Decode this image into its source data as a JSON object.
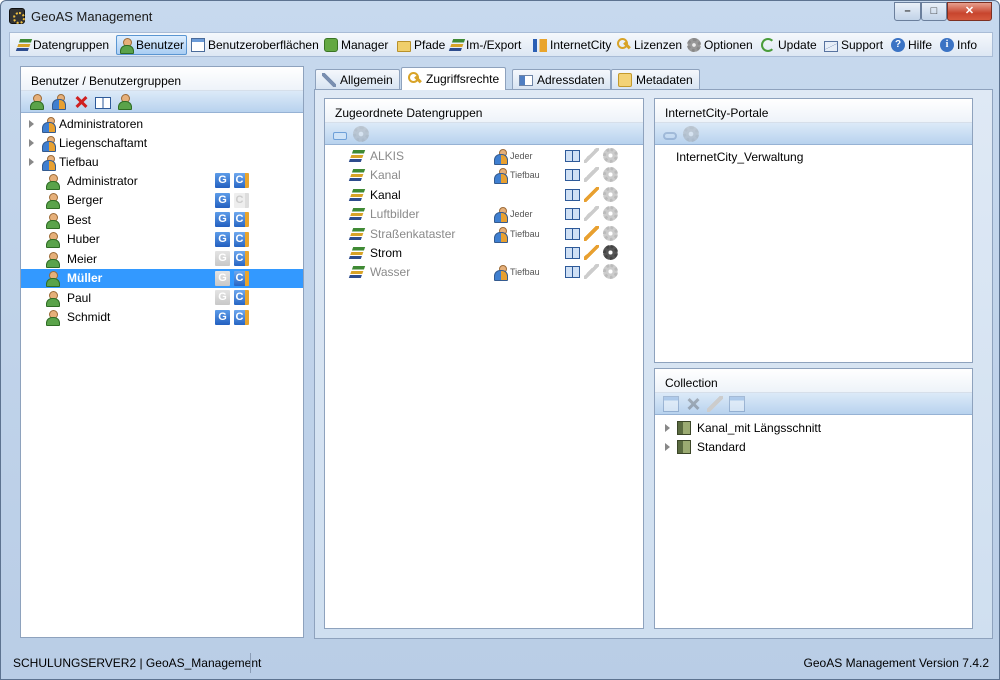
{
  "window": {
    "title": "GeoAS Management",
    "min": "–",
    "max": "□",
    "close": "✕"
  },
  "toolbar": [
    {
      "label": "Datengruppen",
      "icon": "layers-icon"
    },
    {
      "label": "Benutzer",
      "icon": "user-icon"
    },
    {
      "label": "Benutzeroberflächen",
      "icon": "window-icon"
    },
    {
      "label": "Manager",
      "icon": "puzzle-icon"
    },
    {
      "label": "Pfade",
      "icon": "folder-icon"
    },
    {
      "label": "Im-/Export",
      "icon": "layers-icon"
    },
    {
      "label": "InternetCity",
      "icon": "internetcity-icon"
    },
    {
      "label": "Lizenzen",
      "icon": "key-icon"
    },
    {
      "label": "Optionen",
      "icon": "gear-icon"
    },
    {
      "label": "Update",
      "icon": "update-icon"
    },
    {
      "label": "Support",
      "icon": "mail-icon"
    },
    {
      "label": "Hilfe",
      "icon": "help-icon",
      "glyph": "?"
    },
    {
      "label": "Info",
      "icon": "info-icon",
      "glyph": "i"
    }
  ],
  "left_panel": {
    "title": "Benutzer / Benutzergruppen",
    "groups": [
      "Administratoren",
      "Liegenschaftamt",
      "Tiefbau"
    ],
    "users": [
      {
        "name": "Administrator",
        "g": true,
        "c": true
      },
      {
        "name": "Berger",
        "g": true,
        "c": false
      },
      {
        "name": "Best",
        "g": true,
        "c": true
      },
      {
        "name": "Huber",
        "g": true,
        "c": true
      },
      {
        "name": "Meier",
        "g": false,
        "c": true
      },
      {
        "name": "Müller",
        "g": false,
        "c": true,
        "selected": true
      },
      {
        "name": "Paul",
        "g": false,
        "c": true
      },
      {
        "name": "Schmidt",
        "g": true,
        "c": true
      }
    ],
    "badge_g": "G",
    "badge_c": "C"
  },
  "tabs": [
    "Allgemein",
    "Zugriffsrechte",
    "Adressdaten",
    "Metadaten"
  ],
  "datengruppen": {
    "title": "Zugeordnete Datengruppen",
    "rows": [
      {
        "name": "ALKIS",
        "group": "Jeder",
        "active": false,
        "pen": false,
        "gear": false
      },
      {
        "name": "Kanal",
        "group": "Tiefbau",
        "active": false,
        "pen": false,
        "gear": false
      },
      {
        "name": "Kanal",
        "group": "",
        "active": true,
        "pen": true,
        "gear": false
      },
      {
        "name": "Luftbilder",
        "group": "Jeder",
        "active": false,
        "pen": false,
        "gear": false
      },
      {
        "name": "Straßenkataster",
        "group": "Tiefbau",
        "active": false,
        "pen": true,
        "gear": false
      },
      {
        "name": "Strom",
        "group": "",
        "active": true,
        "pen": true,
        "gear": true
      },
      {
        "name": "Wasser",
        "group": "Tiefbau",
        "active": false,
        "pen": false,
        "gear": false
      }
    ]
  },
  "portale": {
    "title": "InternetCity-Portale",
    "items": [
      "InternetCity_Verwaltung"
    ]
  },
  "collection": {
    "title": "Collection",
    "items": [
      "Kanal_mit Längsschnitt",
      "Standard"
    ]
  },
  "status": {
    "left": "SCHULUNGSERVER2 | GeoAS_Management",
    "right": "GeoAS Management Version 7.4.2"
  }
}
